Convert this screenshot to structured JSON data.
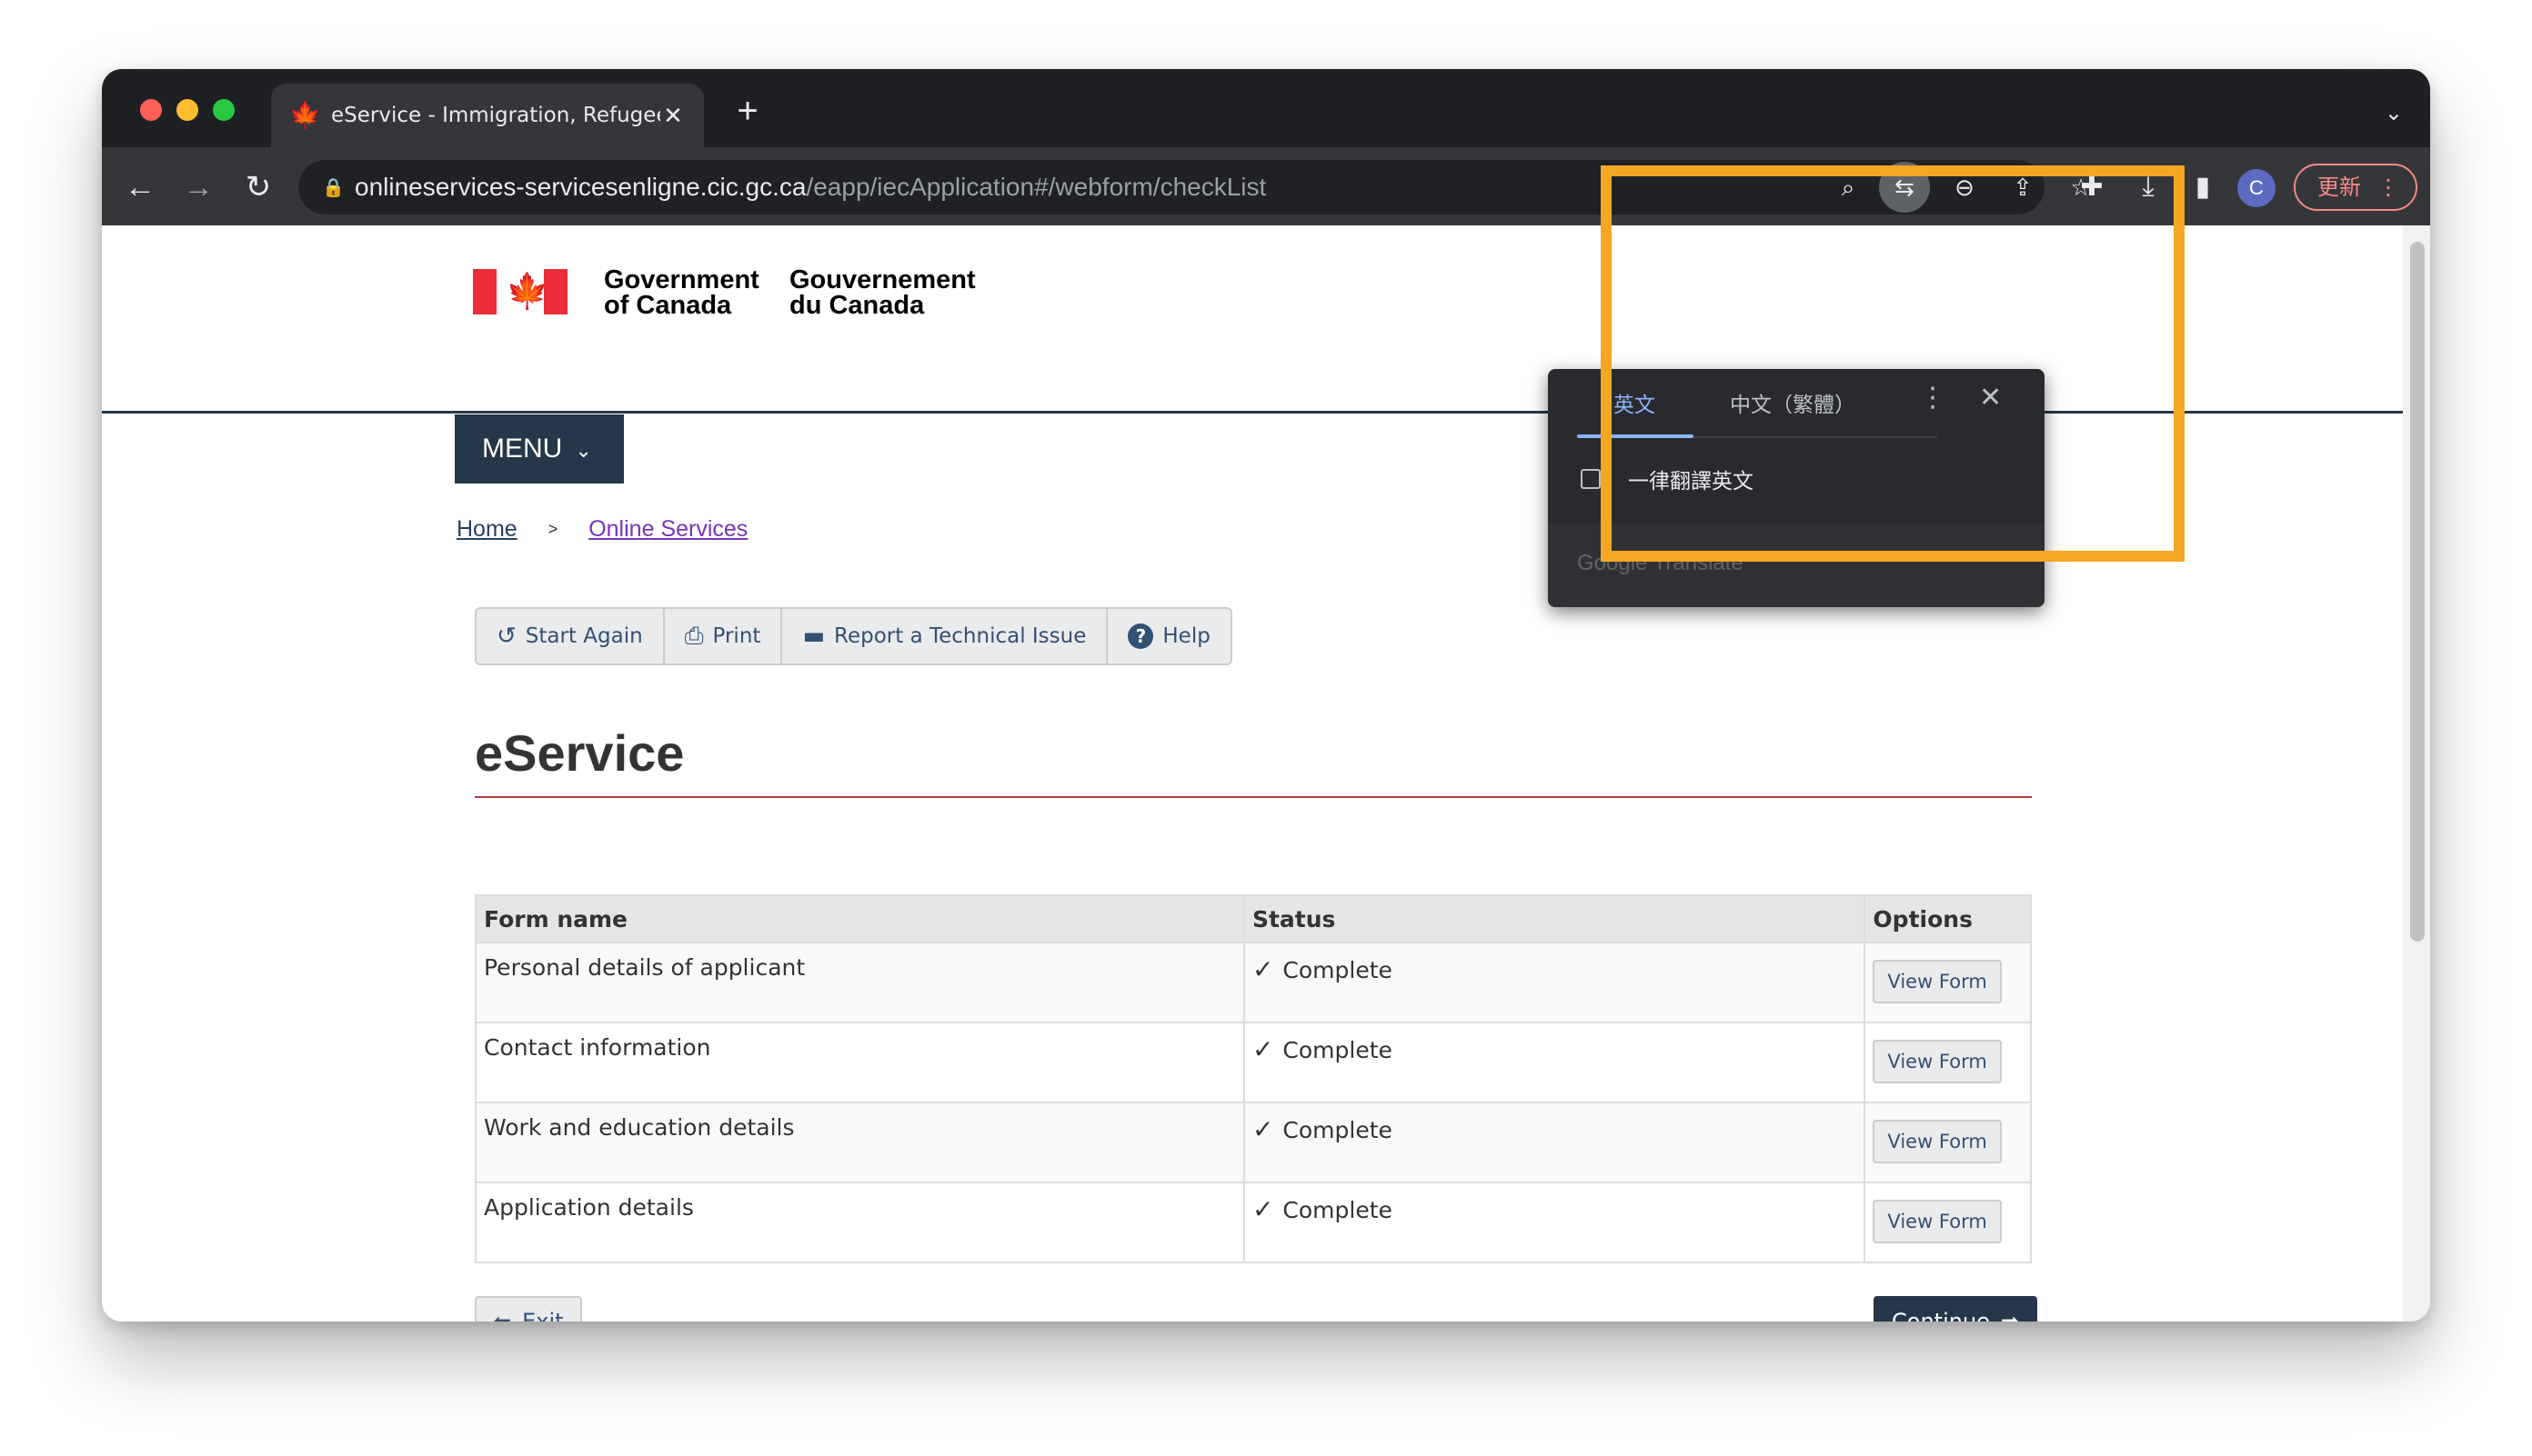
{
  "browser": {
    "tab_title": "eService - Immigration, Refugees",
    "tab_favicon": "maple-leaf-icon",
    "new_tab_label": "+",
    "url_domain": "onlineservices-servicesenligne.cic.gc.ca",
    "url_path": "/eapp/iecApplication#/webform/checkList",
    "avatar_letter": "C",
    "update_label": "更新",
    "accent_highlight": "#f5a623"
  },
  "translate_popup": {
    "tab_source": "英文",
    "tab_target": "中文（繁體）",
    "always_translate": "一律翻譯英文",
    "brand": "Google Translate"
  },
  "gc_header": {
    "sig_en_line1": "Government",
    "sig_en_line2": "of Canada",
    "sig_fr_line1": "Gouvernement",
    "sig_fr_line2": "du Canada"
  },
  "menu": {
    "label": "MENU"
  },
  "breadcrumb": {
    "home": "Home",
    "separator": ">",
    "online_services": "Online Services"
  },
  "actions": {
    "start_again": "Start Again",
    "print": "Print",
    "report_issue": "Report a Technical Issue",
    "help": "Help"
  },
  "page": {
    "title": "eService"
  },
  "table": {
    "headers": {
      "form_name": "Form name",
      "status": "Status",
      "options": "Options"
    },
    "rows": [
      {
        "form_name": "Personal details of applicant",
        "status": "Complete",
        "option": "View Form"
      },
      {
        "form_name": "Contact information",
        "status": "Complete",
        "option": "View Form"
      },
      {
        "form_name": "Work and education details",
        "status": "Complete",
        "option": "View Form"
      },
      {
        "form_name": "Application details",
        "status": "Complete",
        "option": "View Form"
      }
    ]
  },
  "footer_buttons": {
    "exit": "Exit",
    "continue": "Continue"
  }
}
